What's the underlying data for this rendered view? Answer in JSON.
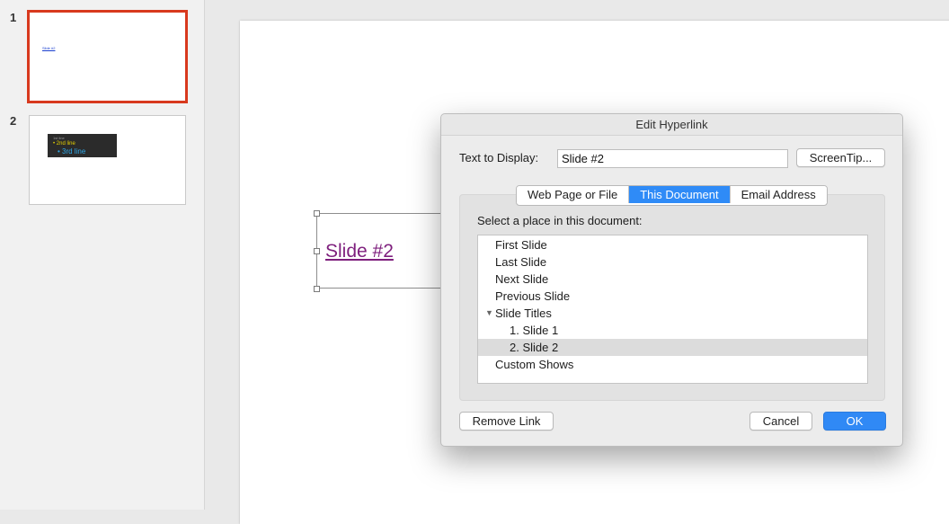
{
  "sidebar": {
    "slides": [
      {
        "number": "1",
        "link_text": "Slide #2"
      },
      {
        "number": "2",
        "line1": "1st line",
        "line2": "• 2nd line",
        "line3": "• 3rd line"
      }
    ]
  },
  "slide": {
    "link_text": "Slide #2"
  },
  "dialog": {
    "title": "Edit Hyperlink",
    "text_to_display_label": "Text to Display:",
    "text_to_display_value": "Slide #2",
    "screentip_label": "ScreenTip...",
    "tabs": [
      {
        "label": "Web Page or File",
        "active": false
      },
      {
        "label": "This Document",
        "active": true
      },
      {
        "label": "Email Address",
        "active": false
      }
    ],
    "select_label": "Select a place in this document:",
    "places": [
      {
        "label": "First Slide"
      },
      {
        "label": "Last Slide"
      },
      {
        "label": "Next Slide"
      },
      {
        "label": "Previous Slide"
      },
      {
        "label": "Slide Titles",
        "expanded": true
      },
      {
        "label": "1. Slide 1"
      },
      {
        "label": "2. Slide 2",
        "selected": true
      },
      {
        "label": "Custom Shows"
      }
    ],
    "remove_link_label": "Remove Link",
    "cancel_label": "Cancel",
    "ok_label": "OK"
  },
  "colors": {
    "accent": "#2f8bf7",
    "selected_slide_border": "#d8391e",
    "visited_link": "#7e1f7d"
  }
}
